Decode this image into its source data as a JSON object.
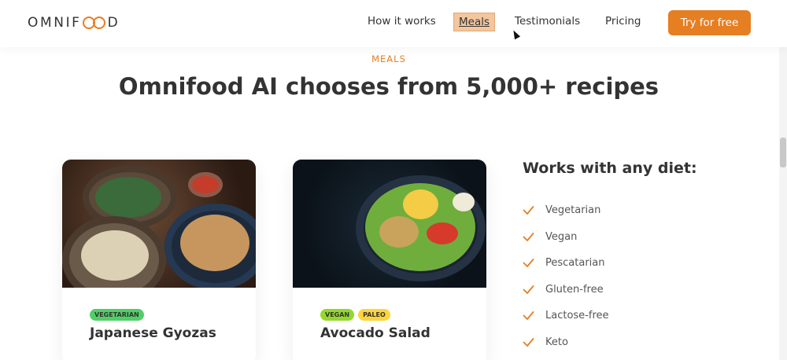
{
  "header": {
    "logo": "OMNIFOOD",
    "nav": [
      "How it works",
      "Meals",
      "Testimonials",
      "Pricing"
    ],
    "cta": "Try for free"
  },
  "section": {
    "eyebrow": "MEALS",
    "title": "Omnifood AI chooses from 5,000+ recipes"
  },
  "cards": [
    {
      "tags": [
        "VEGETARIAN"
      ],
      "title": "Japanese Gyozas"
    },
    {
      "tags": [
        "VEGAN",
        "PALEO"
      ],
      "title": "Avocado Salad"
    }
  ],
  "diet": {
    "heading": "Works with any diet:",
    "items": [
      "Vegetarian",
      "Vegan",
      "Pescatarian",
      "Gluten-free",
      "Lactose-free",
      "Keto"
    ]
  },
  "colors": {
    "accent": "#e67e22",
    "text": "#333333",
    "vegetarian": "#51cf66",
    "vegan": "#94d82d",
    "paleo": "#ffd43b"
  },
  "icons": {
    "check": "check-icon",
    "logo_mark": "double-circle-logo-icon"
  }
}
